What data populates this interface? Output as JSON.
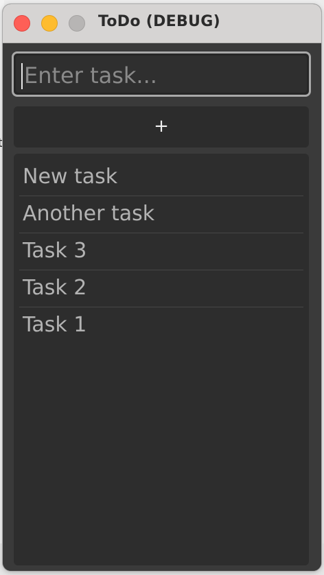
{
  "window": {
    "title": "ToDo (DEBUG)"
  },
  "task_input": {
    "placeholder": "Enter task..."
  },
  "add_button": {
    "label": "+"
  },
  "tasks": [
    {
      "label": "New task"
    },
    {
      "label": "Another task"
    },
    {
      "label": "Task 3"
    },
    {
      "label": "Task 2"
    },
    {
      "label": "Task 1"
    }
  ],
  "colors": {
    "titlebar": "#d6d4d3",
    "window_bg": "#3a3a3a",
    "list_bg": "#2d2d2d",
    "close": "#fe5f57",
    "minimize": "#febc2e",
    "maximize_disabled": "#b7b5b4",
    "task_text": "#b3b3b3"
  }
}
